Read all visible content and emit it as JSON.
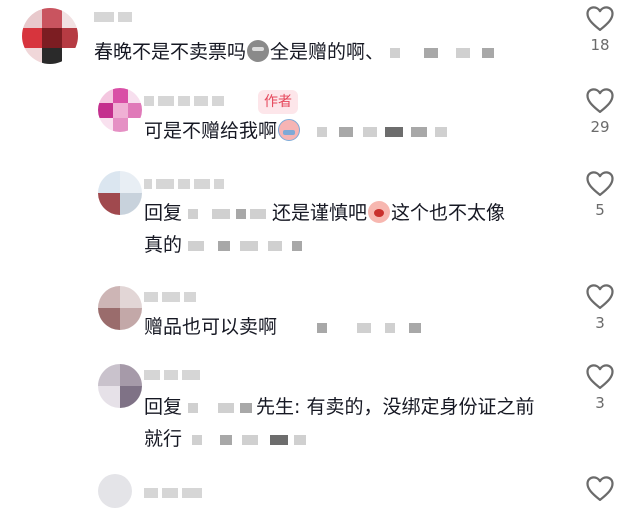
{
  "comments": [
    {
      "text": "春晚不是不卖票吗",
      "emoji": "poop-emoji",
      "text2": "全是赠的啊、",
      "likes": "18"
    },
    {
      "badge": "作者",
      "text": "可是不赠给我啊",
      "emoji": "crying-emoji",
      "likes": "29"
    },
    {
      "line1_a": "回复",
      "line1_b": "还是谨慎吧",
      "emoji": "shocked-emoji",
      "line1_c": "这个也不太像",
      "line2_a": "真的",
      "likes": "5"
    },
    {
      "text": "赠品也可以卖啊",
      "likes": "3"
    },
    {
      "line1_a": "回复",
      "line1_b": "先生: 有卖的，没绑定身份证之前",
      "line2_a": "就行",
      "likes": "3"
    },
    {
      "likes": ""
    }
  ],
  "colors": {
    "author_badge_bg": "#fde6ea",
    "author_badge_text": "#e5475b",
    "text": "#161823",
    "count": "#6b6b6b"
  }
}
